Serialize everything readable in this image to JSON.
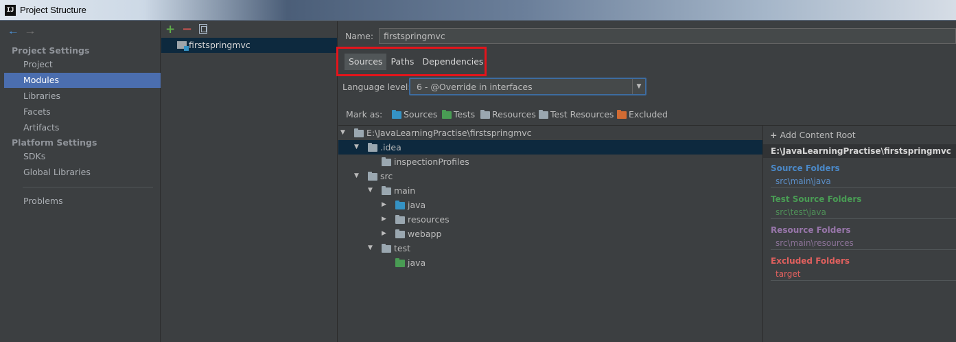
{
  "window": {
    "title": "Project Structure",
    "app_icon": "IJ"
  },
  "sidebar": {
    "sections": [
      {
        "label": "Project Settings",
        "items": [
          "Project",
          "Modules",
          "Libraries",
          "Facets",
          "Artifacts"
        ]
      },
      {
        "label": "Platform Settings",
        "items": [
          "SDKs",
          "Global Libraries"
        ]
      }
    ],
    "extra_item": "Problems",
    "selected": "Modules"
  },
  "modules": {
    "toolbar": {
      "add": "+",
      "remove": "−"
    },
    "items": [
      {
        "name": "firstspringmvc"
      }
    ]
  },
  "detail": {
    "name_label": "Name:",
    "name_value": "firstspringmvc",
    "tabs": [
      "Sources",
      "Paths",
      "Dependencies"
    ],
    "active_tab": "Sources",
    "language_level_label": "Language level:",
    "language_level_value": "6 - @Override in interfaces",
    "mark_as_label": "Mark as:",
    "mark_options": [
      {
        "label": "Sources",
        "color": "#3592c4"
      },
      {
        "label": "Tests",
        "color": "#499c54"
      },
      {
        "label": "Resources",
        "color": "#9aa7b0"
      },
      {
        "label": "Test Resources",
        "color": "#9aa7b0"
      },
      {
        "label": "Excluded",
        "color": "#d16b33"
      }
    ]
  },
  "tree": [
    {
      "label": "E:\\JavaLearningPractise\\firstspringmvc",
      "expanded": true,
      "color": "#9aa7b0"
    },
    {
      "label": ".idea",
      "expanded": true,
      "color": "#9aa7b0",
      "selected": true
    },
    {
      "label": "inspectionProfiles",
      "color": "#9aa7b0"
    },
    {
      "label": "src",
      "expanded": true
    },
    {
      "label": "main",
      "expanded": true,
      "color": "#9aa7b0"
    },
    {
      "label": "java",
      "expanded": false,
      "color": "#3592c4"
    },
    {
      "label": "resources",
      "expanded": false,
      "color": "#9aa7b0"
    },
    {
      "label": "webapp",
      "expanded": false,
      "color": "#9aa7b0"
    },
    {
      "label": "test",
      "expanded": true,
      "color": "#9aa7b0"
    },
    {
      "label": "java",
      "color": "#499c54"
    }
  ],
  "content_root": {
    "add_label": "Add Content Root",
    "path": "E:\\JavaLearningPractise\\firstspringmvc",
    "groups": [
      {
        "title": "Source Folders",
        "value": "src\\main\\java",
        "title_color": "#4a88c7",
        "value_color": "#5c8fc8"
      },
      {
        "title": "Test Source Folders",
        "value": "src\\test\\java",
        "title_color": "#499c54",
        "value_color": "#4f8f58"
      },
      {
        "title": "Resource Folders",
        "value": "src\\main\\resources",
        "title_color": "#9876aa",
        "value_color": "#8a7296"
      },
      {
        "title": "Excluded Folders",
        "value": "target",
        "title_color": "#e0605e",
        "value_color": "#e0605e"
      }
    ]
  }
}
